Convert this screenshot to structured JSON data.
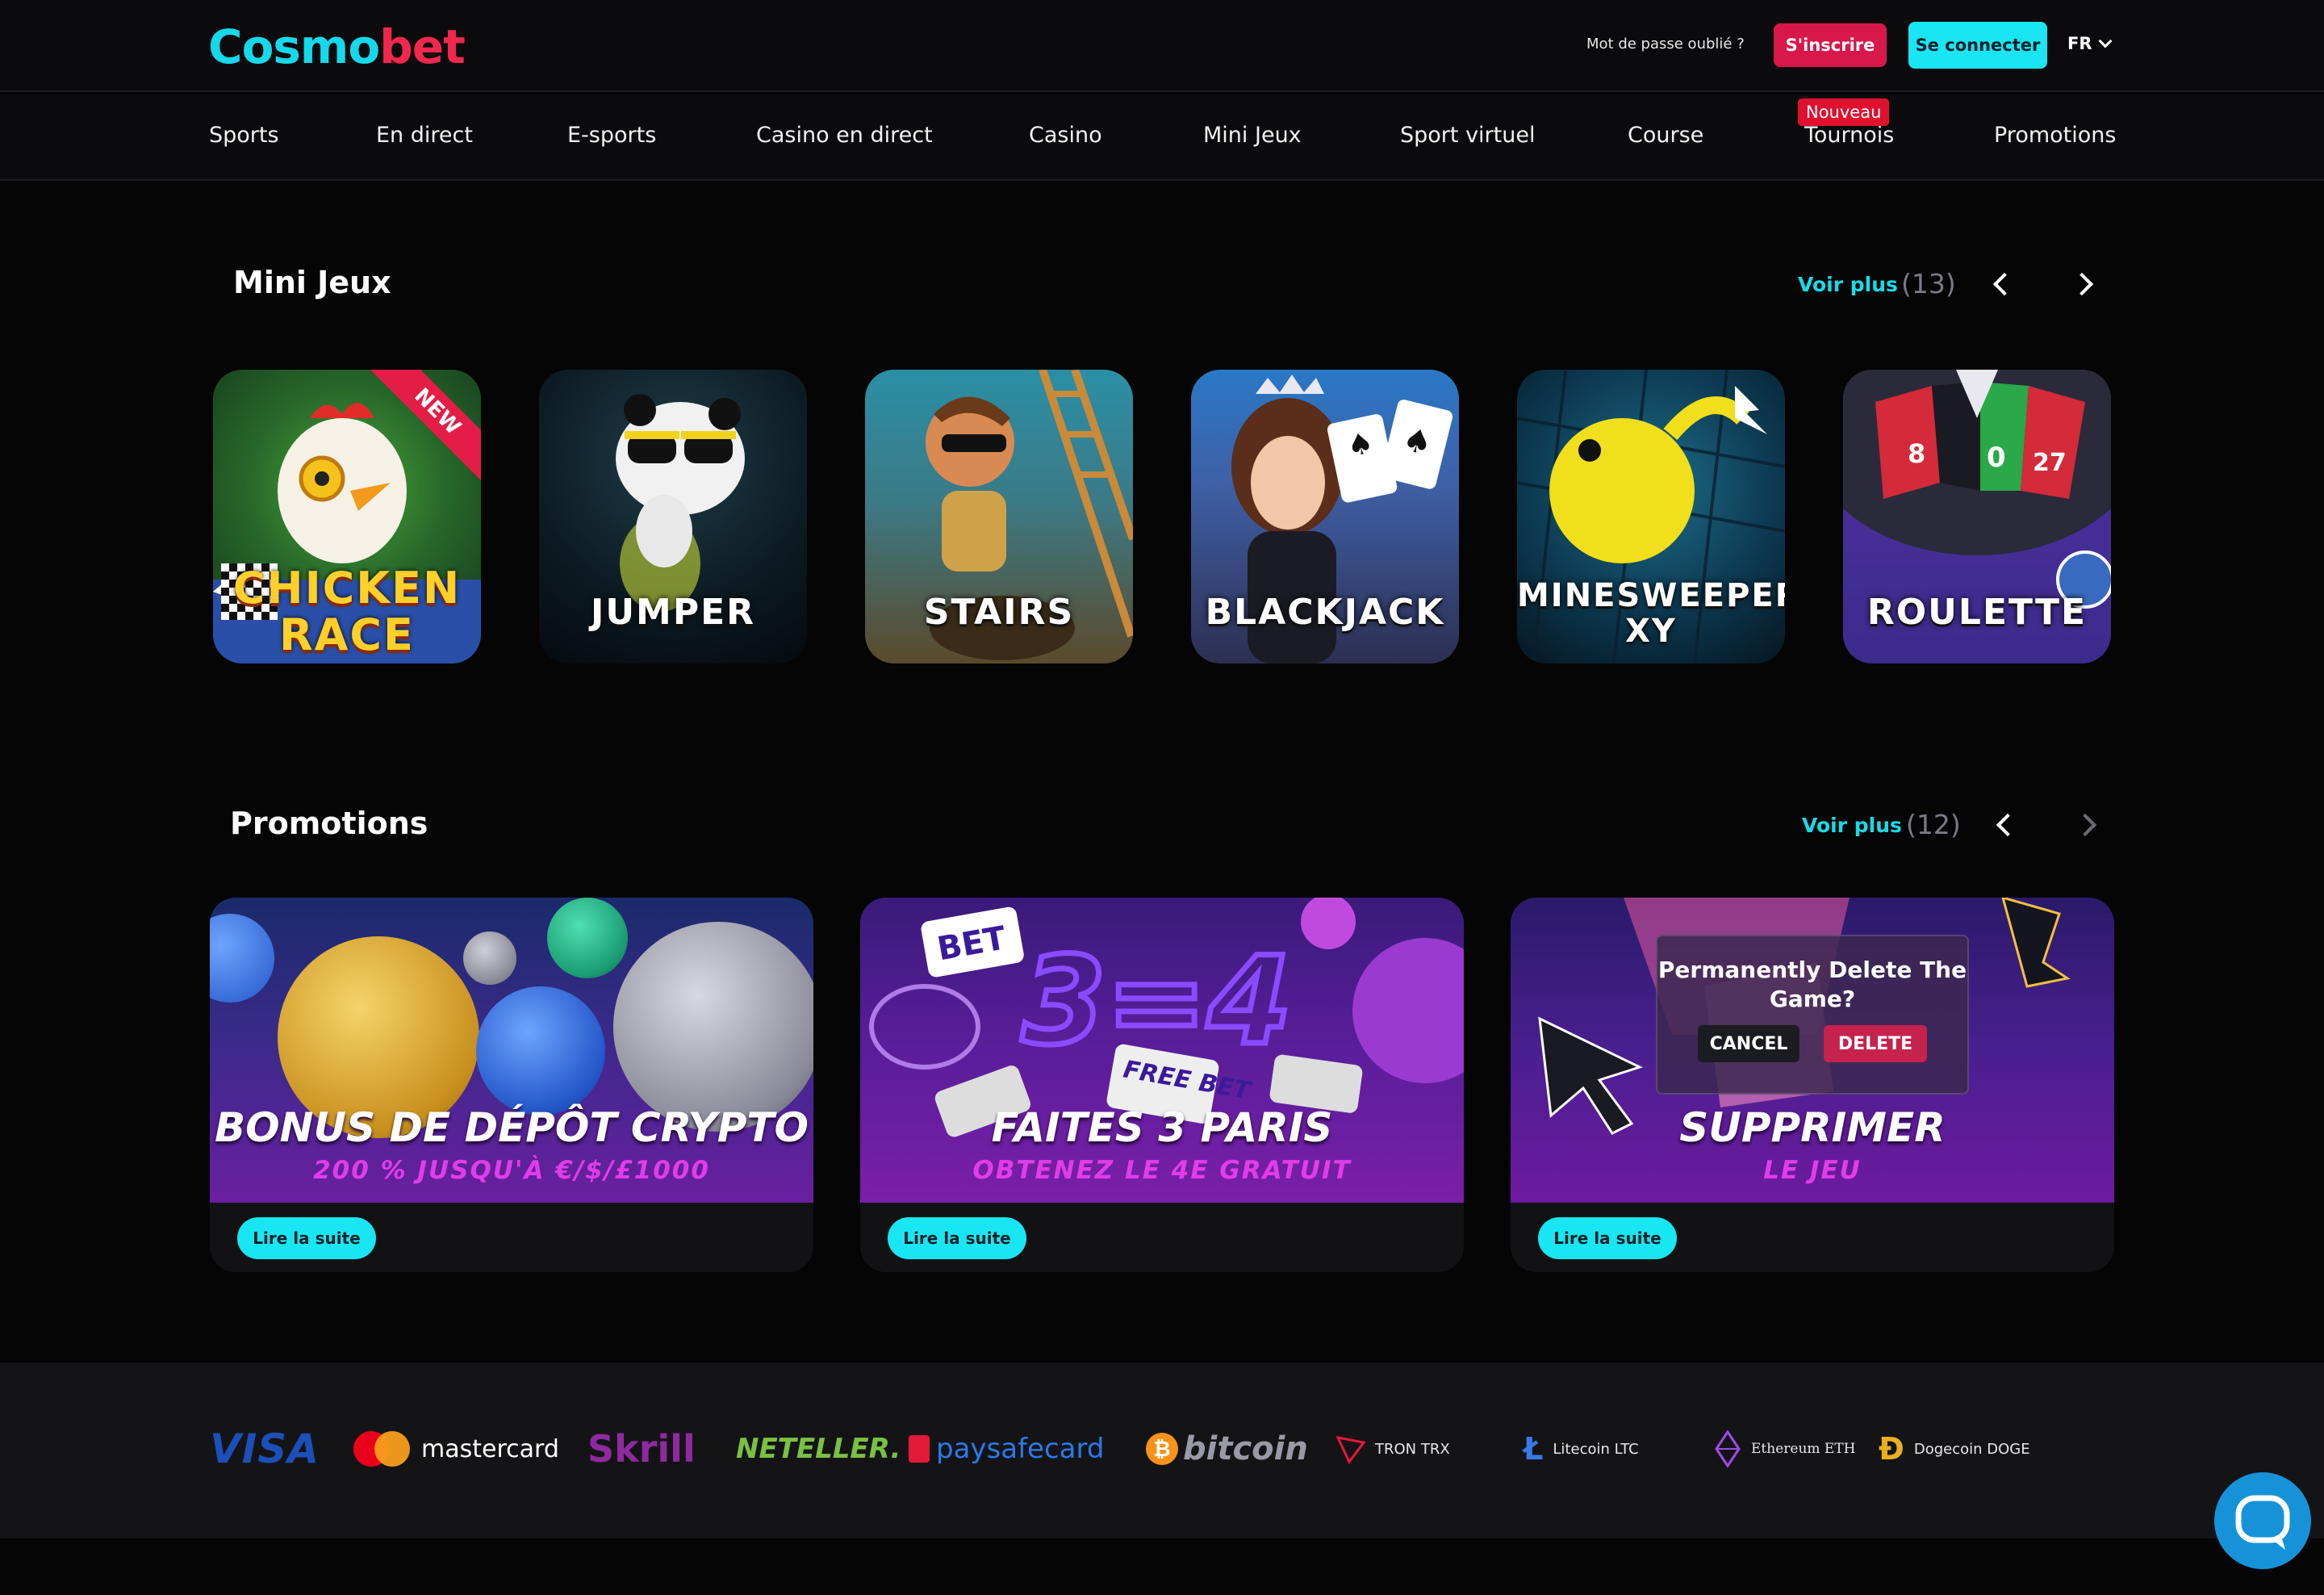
{
  "header": {
    "logo_part1": "Cosmo",
    "logo_part2": "bet",
    "forgot_password": "Mot de passe oublié ?",
    "register": "S'inscrire",
    "login": "Se connecter",
    "language": "FR"
  },
  "nav": {
    "items": [
      "Sports",
      "En direct",
      "E-sports",
      "Casino en direct",
      "Casino",
      "Mini Jeux",
      "Sport virtuel",
      "Course",
      "Tournois",
      "Promotions"
    ],
    "new_badge": "Nouveau"
  },
  "mini_games": {
    "title": "Mini Jeux",
    "see_more": "Voir plus",
    "count": "(13)",
    "games": [
      {
        "name": "CHICKEN RACE",
        "badge": "NEW"
      },
      {
        "name": "JUMPER"
      },
      {
        "name": "STAIRS"
      },
      {
        "name": "BLACKJACK"
      },
      {
        "name": "MINESWEEPER XY"
      },
      {
        "name": "ROULETTE"
      }
    ],
    "roulette_numbers": [
      "8",
      "0",
      "27"
    ]
  },
  "promotions": {
    "title": "Promotions",
    "see_more": "Voir plus",
    "count": "(12)",
    "read_more": "Lire la suite",
    "cards": [
      {
        "title": "BONUS DE DÉPÔT CRYPTO",
        "subtitle": "200 % JUSQU'À €/$/£1000"
      },
      {
        "title": "FAITES 3 PARIS",
        "subtitle": "OBTENEZ LE 4E GRATUIT",
        "art_text": "3=4",
        "bet_tag": "BET",
        "free_bet": "FREE BET"
      },
      {
        "title": "SUPPRIMER",
        "subtitle": "LE JEU",
        "dialog_title": "Permanently Delete The Game?",
        "dialog_cancel": "CANCEL",
        "dialog_delete": "DELETE"
      }
    ]
  },
  "payments": {
    "visa": "VISA",
    "mastercard": "mastercard",
    "skrill": "Skrill",
    "neteller": "NETELLER.",
    "paysafe": "paysafecard",
    "bitcoin": "bitcoin",
    "tron": "TRON TRX",
    "litecoin": "Litecoin LTC",
    "ethereum": "Ethereum ETH",
    "dogecoin": "Dogecoin DOGE"
  },
  "colors": {
    "accent_cyan": "#19e6f2",
    "accent_red": "#d8174a",
    "background": "#050505"
  }
}
